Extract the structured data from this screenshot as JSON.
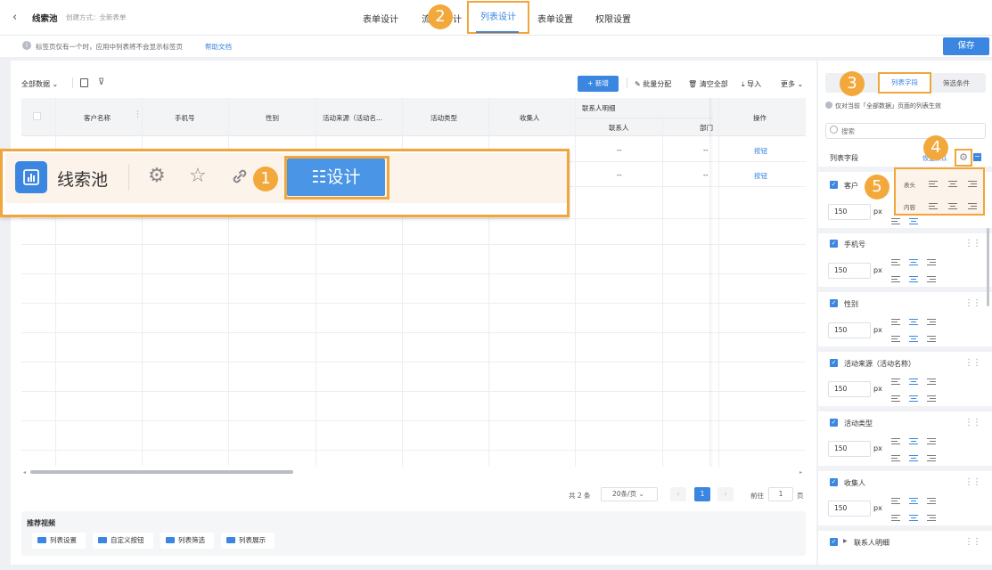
{
  "header": {
    "back": "‹",
    "app_name": "线索池",
    "create_mode": "创建方式：全新表单",
    "tabs": [
      "表单设计",
      "流程设计",
      "列表设计",
      "表单设置",
      "权限设置"
    ],
    "active_tab": "列表设计",
    "tab_partial_1": "流",
    "tab_partial_2": "计"
  },
  "notice": {
    "text": "标签页仅有一个时，应用中列表将不会显示标签页",
    "link": "帮助文档"
  },
  "save_label": "保存",
  "toolbar": {
    "view": "全部数据",
    "new": "+ 新增",
    "batch_assign": "批量分配",
    "clear_all": "清空全部",
    "import": "导入",
    "more": "更多"
  },
  "table": {
    "headers": [
      "客户名称",
      "手机号",
      "性别",
      "活动来源（活动名...",
      "活动类型",
      "收集人"
    ],
    "group_header": "联系人明细",
    "sub_headers": [
      "联系人",
      "部门"
    ],
    "action_header": "操作",
    "rows": [
      {
        "contact": "--",
        "dept": "--",
        "action": "按钮"
      },
      {
        "contact": "--",
        "dept": "--",
        "action": "按钮"
      }
    ]
  },
  "pager": {
    "total": "共 2 条",
    "page_size": "20条/页",
    "current": "1",
    "goto_label": "前往",
    "goto_value": "1",
    "page_unit": "页"
  },
  "recommend": {
    "title": "推荐视频",
    "videos": [
      "列表设置",
      "自定义按钮",
      "列表筛选",
      "列表展示"
    ]
  },
  "overlay": {
    "title": "线索池",
    "design_button": "☷设计"
  },
  "badges": [
    "1",
    "2",
    "3",
    "4",
    "5"
  ],
  "right_panel": {
    "tabs": [
      "列表字段",
      "筛选条件"
    ],
    "info": "仅对当前「全部数据」页面的列表生效",
    "search_placeholder": "搜索",
    "section_label": "列表字段",
    "restore": "恢复默认",
    "popup": {
      "header_label": "表头",
      "content_label": "内容"
    },
    "fields": [
      {
        "name": "客户",
        "width": "150",
        "unit": "px"
      },
      {
        "name": "手机号",
        "width": "150",
        "unit": "px"
      },
      {
        "name": "性别",
        "width": "150",
        "unit": "px"
      },
      {
        "name": "活动来源（活动名称）",
        "width": "150",
        "unit": "px"
      },
      {
        "name": "活动类型",
        "width": "150",
        "unit": "px"
      },
      {
        "name": "收集人",
        "width": "150",
        "unit": "px"
      }
    ],
    "group_field": "联系人明细"
  },
  "colors": {
    "primary": "#3b86e0",
    "highlight": "#f0a63a",
    "badge": "#f3a83b"
  }
}
